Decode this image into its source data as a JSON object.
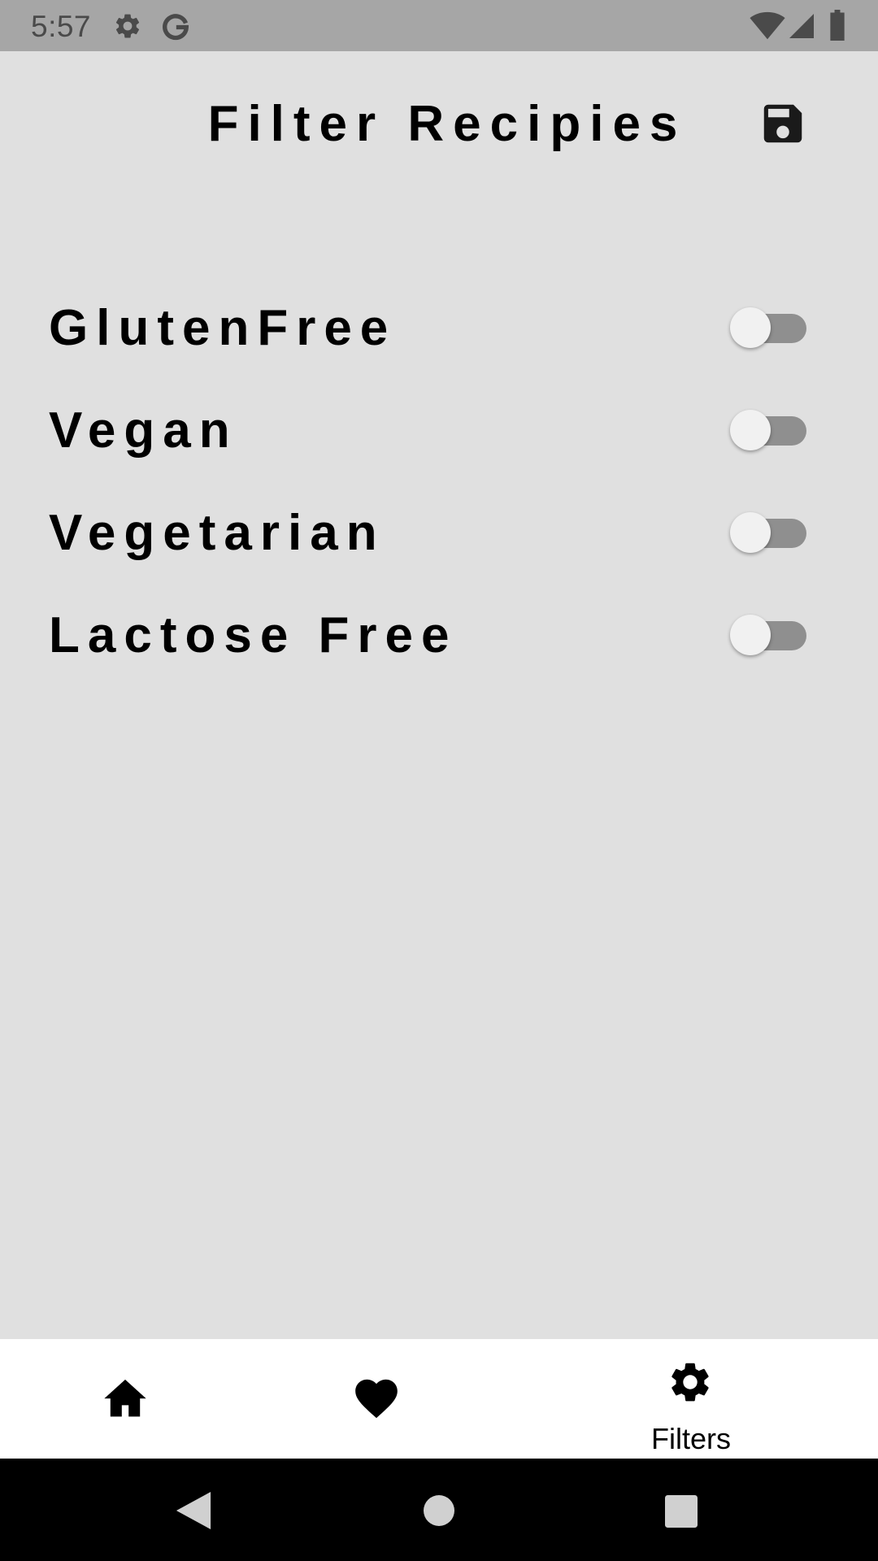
{
  "status_bar": {
    "time": "5:57",
    "icons": [
      "gear-icon",
      "google-g-icon",
      "wifi-icon",
      "signal-icon",
      "battery-icon"
    ]
  },
  "app_bar": {
    "title": "Filter Recipies",
    "actions": [
      "save-icon"
    ]
  },
  "filters": [
    {
      "label": "GlutenFree",
      "enabled": false
    },
    {
      "label": "Vegan",
      "enabled": false
    },
    {
      "label": "Vegetarian",
      "enabled": false
    },
    {
      "label": "Lactose Free",
      "enabled": false
    }
  ],
  "bottom_nav": {
    "items": [
      {
        "icon": "home-icon",
        "label": ""
      },
      {
        "icon": "heart-icon",
        "label": ""
      },
      {
        "icon": "gear-icon",
        "label": "Filters",
        "selected": true
      }
    ]
  },
  "system_nav": [
    "back-icon",
    "home-circle-icon",
    "recents-icon"
  ],
  "colors": {
    "status_bar": "#a6a6a6",
    "background": "#e0e0e0",
    "toggle_track": "#8f8f8f",
    "toggle_thumb": "#f1f1f1",
    "bottom_nav": "#ffffff",
    "system_nav": "#000000"
  }
}
